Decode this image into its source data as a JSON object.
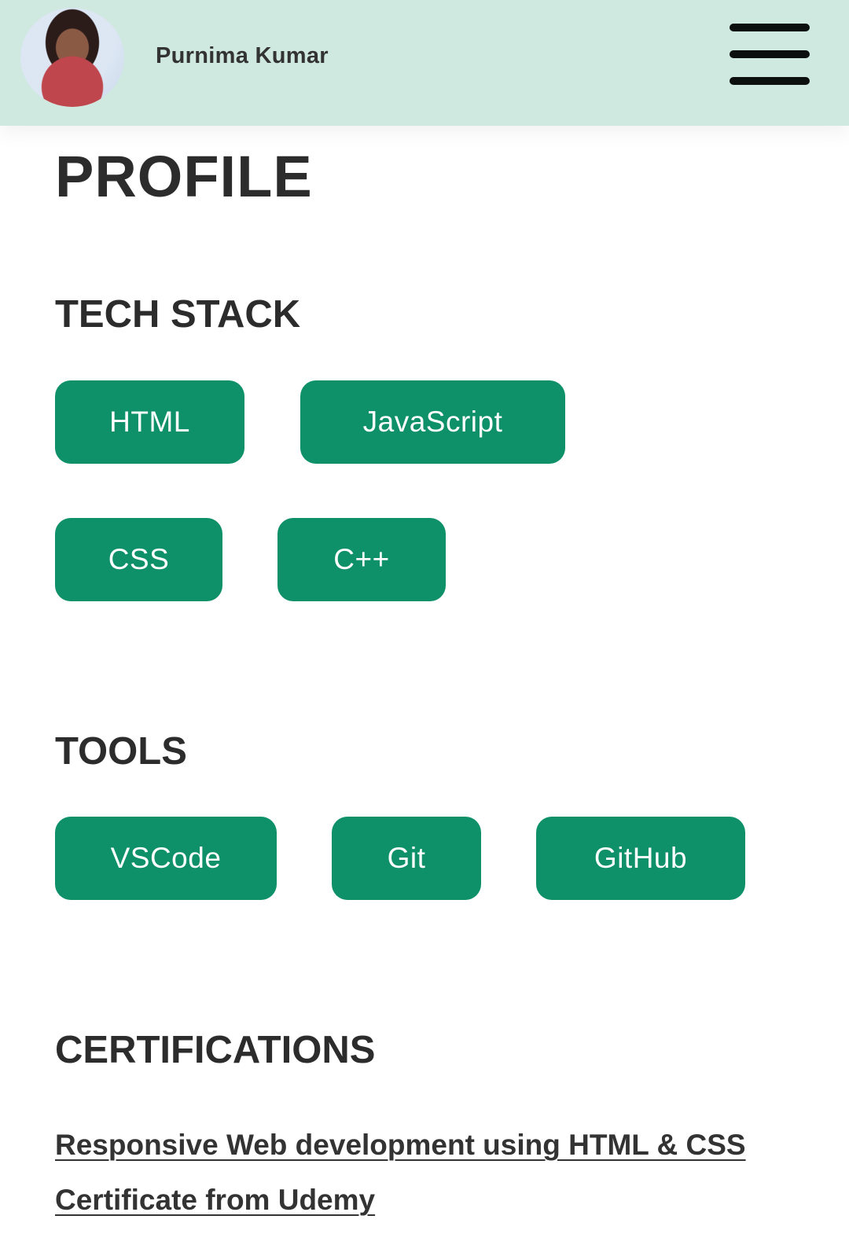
{
  "header": {
    "user_name": "Purnima Kumar"
  },
  "profile": {
    "title": "PROFILE"
  },
  "tech_stack": {
    "title": "TECH STACK",
    "items": [
      "HTML",
      "JavaScript",
      "CSS",
      "C++"
    ]
  },
  "tools": {
    "title": "TOOLS",
    "items": [
      "VSCode",
      "Git",
      "GitHub"
    ]
  },
  "certifications": {
    "title": "CERTIFICATIONS",
    "items": [
      "Responsive Web development using HTML & CSS Certificate from Udemy"
    ]
  },
  "colors": {
    "header_bg": "#cfe8e0",
    "chip_bg": "#0e9068",
    "chip_text": "#ffffff",
    "heading_text": "#2c2c2c"
  },
  "icons": {
    "menu": "hamburger-menu-icon",
    "avatar": "user-avatar-photo"
  }
}
